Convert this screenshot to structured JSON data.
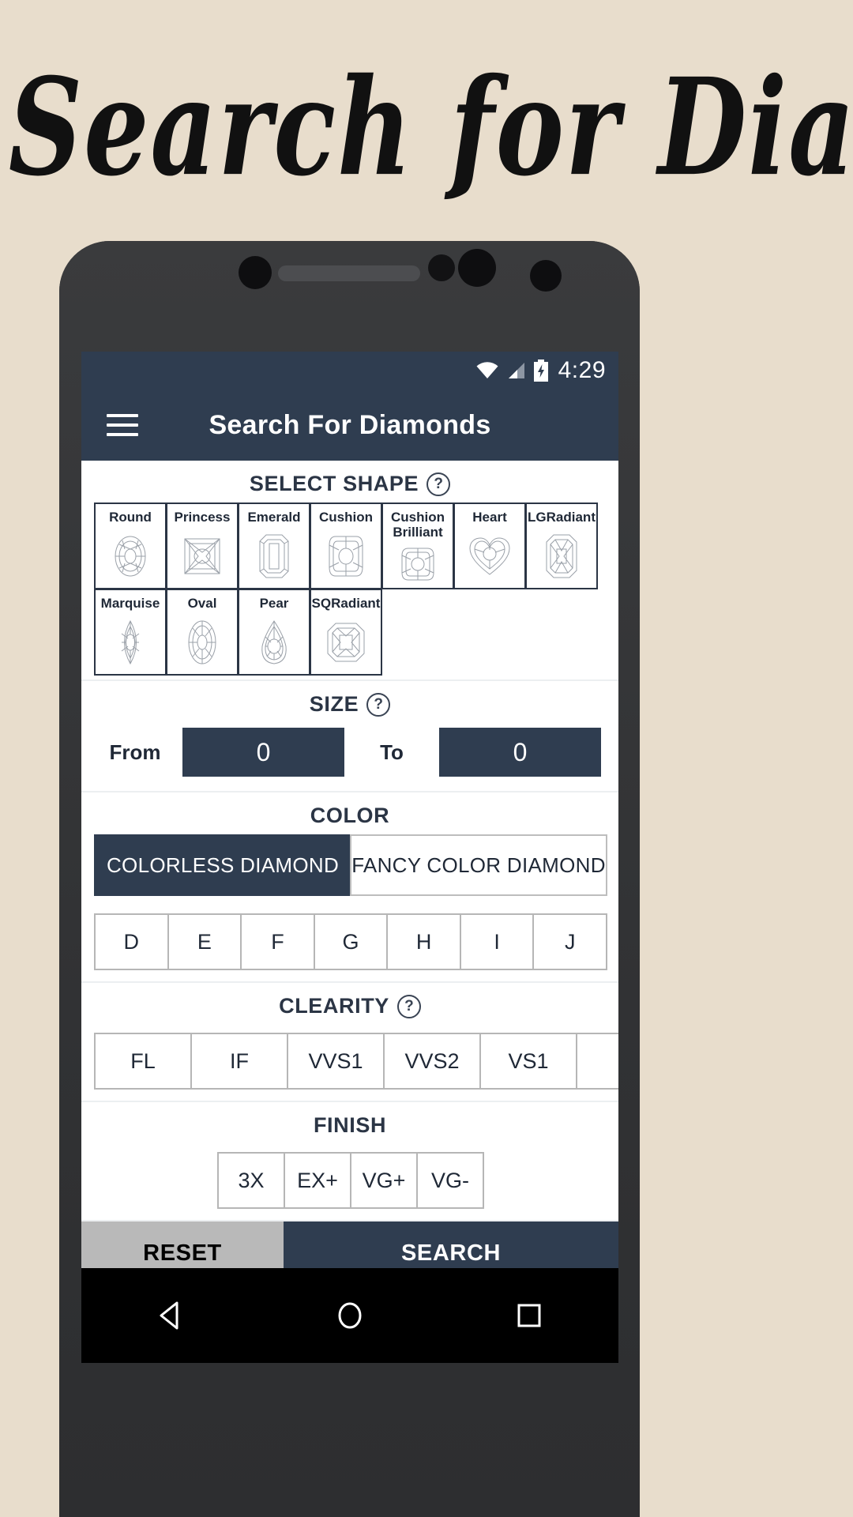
{
  "banner": {
    "title": "Search for  Diamond"
  },
  "statusbar": {
    "time": "4:29",
    "icons": [
      "wifi-icon",
      "signal-icon",
      "battery-charging-icon"
    ]
  },
  "appbar": {
    "menu_icon": "hamburger-menu-icon",
    "title": "Search For Diamonds"
  },
  "sections": {
    "shape": {
      "title": "SELECT SHAPE",
      "help": "?",
      "options": [
        {
          "label": "Round",
          "art": "round-diamond-icon"
        },
        {
          "label": "Princess",
          "art": "princess-diamond-icon"
        },
        {
          "label": "Emerald",
          "art": "emerald-diamond-icon"
        },
        {
          "label": "Cushion",
          "art": "cushion-diamond-icon"
        },
        {
          "label": "Cushion Brilliant",
          "art": "cushion-brilliant-diamond-icon"
        },
        {
          "label": "Heart",
          "art": "heart-diamond-icon"
        },
        {
          "label": "LGRadiant",
          "art": "lgradiant-diamond-icon"
        },
        {
          "label": "Marquise",
          "art": "marquise-diamond-icon"
        },
        {
          "label": "Oval",
          "art": "oval-diamond-icon"
        },
        {
          "label": "Pear",
          "art": "pear-diamond-icon"
        },
        {
          "label": "SQRadiant",
          "art": "sqradiant-diamond-icon"
        }
      ]
    },
    "size": {
      "title": "SIZE",
      "help": "?",
      "from_label": "From",
      "from_value": "0",
      "to_label": "To",
      "to_value": "0"
    },
    "color": {
      "title": "COLOR",
      "tabs": [
        {
          "label": "COLORLESS DIAMOND",
          "active": true
        },
        {
          "label": "FANCY COLOR DIAMOND",
          "active": false
        }
      ],
      "grades": [
        "D",
        "E",
        "F",
        "G",
        "H",
        "I",
        "J"
      ]
    },
    "clarity": {
      "title": "CLEARITY",
      "help": "?",
      "grades": [
        "FL",
        "IF",
        "VVS1",
        "VVS2",
        "VS1"
      ]
    },
    "finish": {
      "title": "FINISH",
      "grades": [
        "3X",
        "EX+",
        "VG+",
        "VG-"
      ]
    }
  },
  "actions": {
    "reset_label": "RESET",
    "search_label": "SEARCH"
  },
  "navbar": {
    "back": "back-triangle-icon",
    "home": "home-circle-icon",
    "recents": "recents-square-icon"
  },
  "colors": {
    "page_background": "#e8ddcc",
    "accent_navy": "#2f3d50",
    "phone_body": "#333436",
    "reset_gray": "#b9b9b9",
    "screen_white": "#ffffff"
  }
}
